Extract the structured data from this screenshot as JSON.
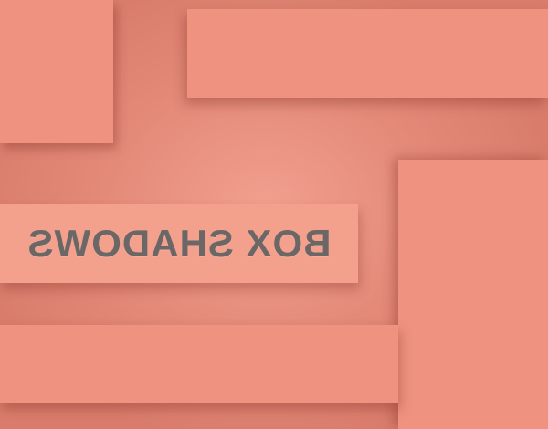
{
  "title": {
    "text": "BOX SHADOWS",
    "mirrored": true
  },
  "colors": {
    "background": "#e48a79",
    "panel": "#ef9280",
    "title_panel": "#f3a08d",
    "text": "#6a6766"
  }
}
